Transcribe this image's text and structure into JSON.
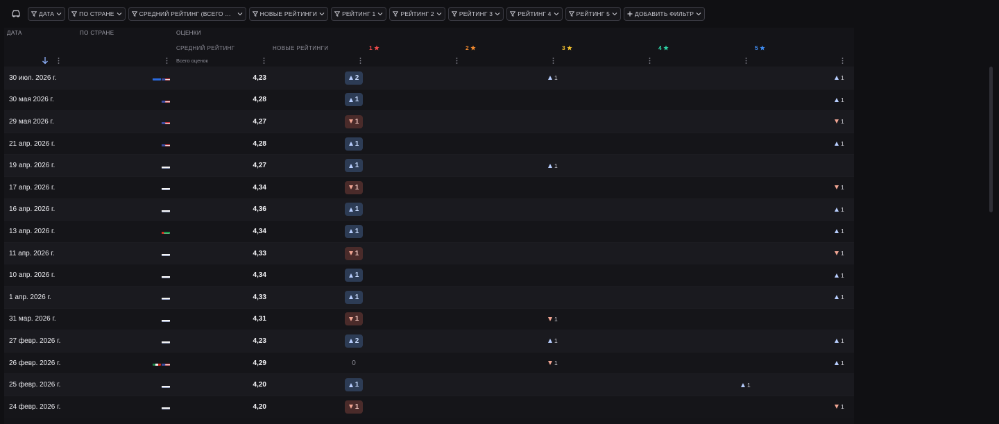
{
  "filters": [
    {
      "label": "ДАТА"
    },
    {
      "label": "ПО СТРАНЕ"
    },
    {
      "label": "СРЕДНИЙ РЕЙТИНГ (ВСЕГО ОЦЕНО..."
    },
    {
      "label": "НОВЫЕ РЕЙТИНГИ"
    },
    {
      "label": "РЕЙТИНГ 1"
    },
    {
      "label": "РЕЙТИНГ 2"
    },
    {
      "label": "РЕЙТИНГ 3"
    },
    {
      "label": "РЕЙТИНГ 4"
    },
    {
      "label": "РЕЙТИНГ 5"
    }
  ],
  "add_filter_label": "ДОБАВИТЬ ФИЛЬТР",
  "headers": {
    "date": "ДАТА",
    "country": "ПО СТРАНЕ",
    "ratings_group": "ОЦЕНКИ",
    "avg": "СРЕДНИЙ РЕЙТИНГ",
    "avg_sub": "Всего оценок",
    "new": "НОВЫЕ РЕЙТИНГИ",
    "stars": [
      {
        "label": "1",
        "color": "#ef4b4b"
      },
      {
        "label": "2",
        "color": "#f28a2e"
      },
      {
        "label": "3",
        "color": "#f2c12e"
      },
      {
        "label": "4",
        "color": "#2ed3a6"
      },
      {
        "label": "5",
        "color": "#3f8cf2"
      }
    ]
  },
  "colors": {
    "up": "#b8ceff",
    "down": "#f1a593"
  },
  "rows": [
    {
      "date": "30 июл. 2026 г.",
      "flags": [
        "ua",
        "us"
      ],
      "avg": "4,23",
      "new": {
        "dir": "up",
        "val": "2"
      },
      "r": [
        {
          "col": 2,
          "dir": "up",
          "val": "1"
        },
        {
          "col": 5,
          "dir": "up",
          "val": "1"
        }
      ]
    },
    {
      "date": "30 мая 2026 г.",
      "flags": [
        "us"
      ],
      "avg": "4,28",
      "new": {
        "dir": "up",
        "val": "1"
      },
      "r": [
        {
          "col": 5,
          "dir": "up",
          "val": "1"
        }
      ]
    },
    {
      "date": "29 мая 2026 г.",
      "flags": [
        "us"
      ],
      "avg": "4,27",
      "new": {
        "dir": "down",
        "val": "1"
      },
      "r": [
        {
          "col": 5,
          "dir": "down",
          "val": "1"
        }
      ]
    },
    {
      "date": "21 апр. 2026 г.",
      "flags": [
        "us"
      ],
      "avg": "4,28",
      "new": {
        "dir": "up",
        "val": "1"
      },
      "r": [
        {
          "col": 5,
          "dir": "up",
          "val": "1"
        }
      ]
    },
    {
      "date": "19 апр. 2026 г.",
      "flags": [
        "ru"
      ],
      "avg": "4,27",
      "new": {
        "dir": "up",
        "val": "1"
      },
      "r": [
        {
          "col": 2,
          "dir": "up",
          "val": "1"
        }
      ]
    },
    {
      "date": "17 апр. 2026 г.",
      "flags": [
        "ru"
      ],
      "avg": "4,34",
      "new": {
        "dir": "down",
        "val": "1"
      },
      "r": [
        {
          "col": 5,
          "dir": "down",
          "val": "1"
        }
      ]
    },
    {
      "date": "16 апр. 2026 г.",
      "flags": [
        "ru"
      ],
      "avg": "4,36",
      "new": {
        "dir": "up",
        "val": "1"
      },
      "r": [
        {
          "col": 5,
          "dir": "up",
          "val": "1"
        }
      ]
    },
    {
      "date": "13 апр. 2026 г.",
      "flags": [
        "ae"
      ],
      "avg": "4,34",
      "new": {
        "dir": "up",
        "val": "1"
      },
      "r": [
        {
          "col": 5,
          "dir": "up",
          "val": "1"
        }
      ]
    },
    {
      "date": "11 апр. 2026 г.",
      "flags": [
        "ru"
      ],
      "avg": "4,33",
      "new": {
        "dir": "down",
        "val": "1"
      },
      "r": [
        {
          "col": 5,
          "dir": "down",
          "val": "1"
        }
      ]
    },
    {
      "date": "10 апр. 2026 г.",
      "flags": [
        "ru"
      ],
      "avg": "4,34",
      "new": {
        "dir": "up",
        "val": "1"
      },
      "r": [
        {
          "col": 5,
          "dir": "up",
          "val": "1"
        }
      ]
    },
    {
      "date": "1 апр. 2026 г.",
      "flags": [
        "ru"
      ],
      "avg": "4,33",
      "new": {
        "dir": "up",
        "val": "1"
      },
      "r": [
        {
          "col": 5,
          "dir": "up",
          "val": "1"
        }
      ]
    },
    {
      "date": "31 мар. 2026 г.",
      "flags": [
        "ru"
      ],
      "avg": "4,31",
      "new": {
        "dir": "down",
        "val": "1"
      },
      "r": [
        {
          "col": 2,
          "dir": "down",
          "val": "1"
        }
      ]
    },
    {
      "date": "27 февр. 2026 г.",
      "flags": [
        "ru"
      ],
      "avg": "4,23",
      "new": {
        "dir": "up",
        "val": "2"
      },
      "r": [
        {
          "col": 2,
          "dir": "up",
          "val": "1"
        },
        {
          "col": 5,
          "dir": "up",
          "val": "1"
        }
      ]
    },
    {
      "date": "26 февр. 2026 г.",
      "flags": [
        "mx",
        "us"
      ],
      "avg": "4,29",
      "new": {
        "dir": "zero",
        "val": "0"
      },
      "r": [
        {
          "col": 2,
          "dir": "down",
          "val": "1"
        },
        {
          "col": 5,
          "dir": "up",
          "val": "1"
        }
      ]
    },
    {
      "date": "25 февр. 2026 г.",
      "flags": [
        "ru"
      ],
      "avg": "4,20",
      "new": {
        "dir": "up",
        "val": "1"
      },
      "r": [
        {
          "col": 4,
          "dir": "up",
          "val": "1"
        }
      ]
    },
    {
      "date": "24 февр. 2026 г.",
      "flags": [
        "ru"
      ],
      "avg": "4,20",
      "new": {
        "dir": "down",
        "val": "1"
      },
      "r": [
        {
          "col": 5,
          "dir": "down",
          "val": "1"
        }
      ]
    }
  ]
}
